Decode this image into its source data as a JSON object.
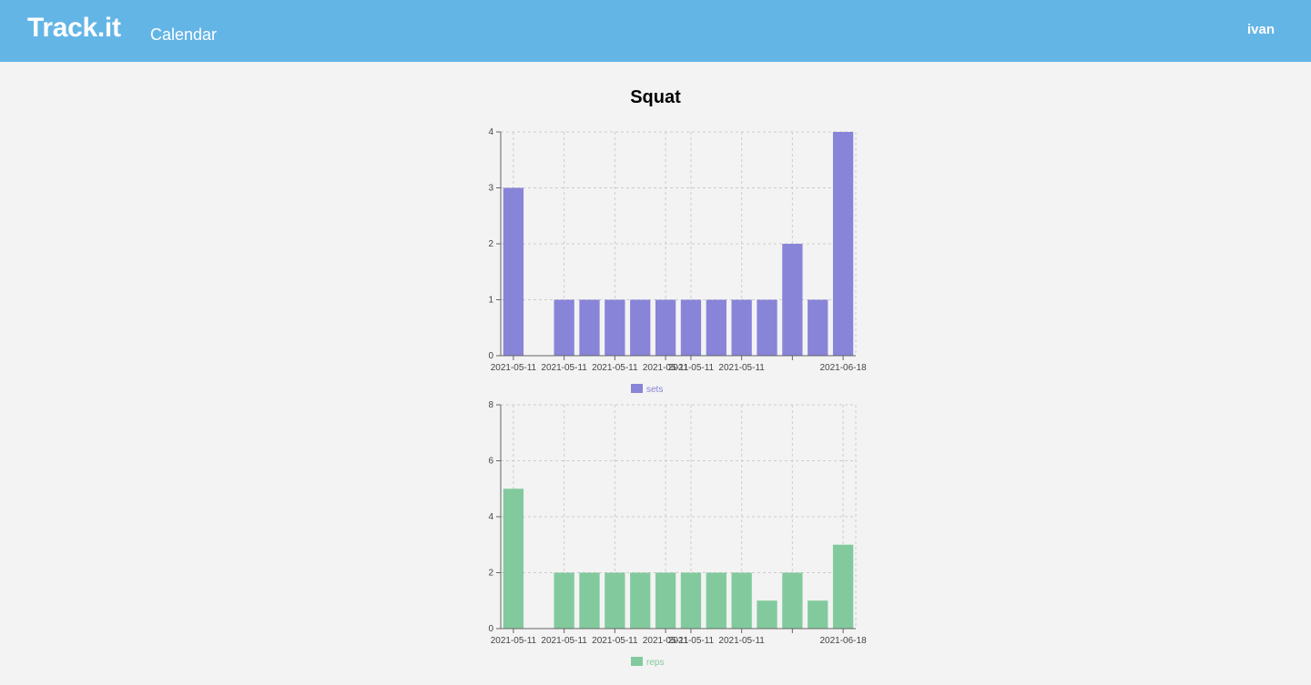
{
  "header": {
    "brand": "Track.it",
    "nav": [
      {
        "label": "Calendar"
      }
    ],
    "user": "ivan"
  },
  "page": {
    "title": "Squat"
  },
  "chart_data": [
    {
      "type": "bar",
      "categories": [
        "2021-05-11",
        "2021-05-11",
        "2021-05-11",
        "2021-05-11",
        "2021-05-11",
        "2021-05-11",
        "2021-05-11",
        "2021-05-11",
        "2021-05-11",
        "2021-05-11",
        "2021-05-11",
        "2021-05-11",
        "2021-05-11",
        "2021-06-18"
      ],
      "tick_labels": [
        "2021-05-11",
        "2021-05-11",
        "2021-05-11",
        "2021-05-11",
        "2021-05-11",
        "2021-05-11",
        "",
        "2021-06-18"
      ],
      "series": [
        {
          "name": "sets",
          "values": [
            3,
            0,
            1,
            1,
            1,
            1,
            1,
            1,
            1,
            1,
            1,
            2,
            1,
            4
          ],
          "color": "#8884d8"
        }
      ],
      "ylim": [
        0,
        4
      ],
      "yticks": [
        0,
        1,
        2,
        3,
        4
      ],
      "grid": true,
      "legend": "bottom"
    },
    {
      "type": "bar",
      "categories": [
        "2021-05-11",
        "2021-05-11",
        "2021-05-11",
        "2021-05-11",
        "2021-05-11",
        "2021-05-11",
        "2021-05-11",
        "2021-05-11",
        "2021-05-11",
        "2021-05-11",
        "2021-05-11",
        "2021-05-11",
        "2021-05-11",
        "2021-06-18"
      ],
      "tick_labels": [
        "2021-05-11",
        "2021-05-11",
        "2021-05-11",
        "2021-05-11",
        "2021-05-11",
        "2021-05-11",
        "",
        "2021-06-18"
      ],
      "series": [
        {
          "name": "reps",
          "values": [
            5,
            0,
            2,
            2,
            2,
            2,
            2,
            2,
            2,
            2,
            1,
            2,
            1,
            3
          ],
          "color": "#82ca9d"
        }
      ],
      "ylim": [
        0,
        8
      ],
      "yticks": [
        0,
        2,
        4,
        6,
        8
      ],
      "grid": true,
      "legend": "bottom"
    }
  ]
}
